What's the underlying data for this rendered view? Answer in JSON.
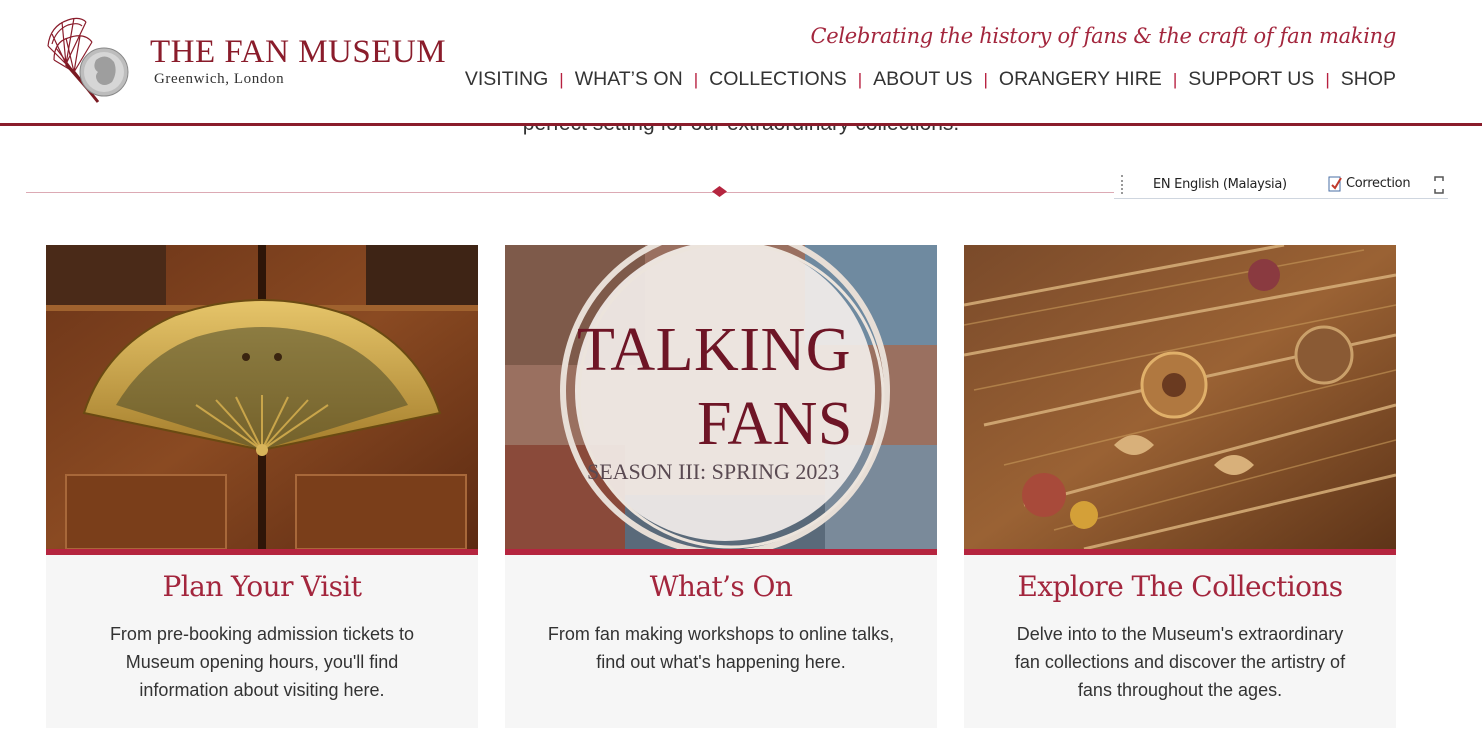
{
  "brand": {
    "title": "THE FAN MUSEUM",
    "subtitle": "Greenwich, London",
    "tagline": "Celebrating the history of fans & the craft of fan making",
    "logo_icon": "fan-and-coin-logo"
  },
  "nav": {
    "items": [
      "VISITING",
      "WHAT’S ON",
      "COLLECTIONS",
      "ABOUT US",
      "ORANGERY HIRE",
      "SUPPORT US",
      "SHOP"
    ],
    "separator": "|"
  },
  "intro": {
    "text": "perfect setting for our extraordinary collections."
  },
  "toolbar": {
    "language": "EN English (Malaysia)",
    "correction": "Correction"
  },
  "cards": [
    {
      "title": "Plan Your Visit",
      "description": "From pre-booking admission tickets to Museum opening hours, you'll find information about visiting here.",
      "image": "gilded-fan-on-wooden-door"
    },
    {
      "title": "What’s On",
      "description": "From fan making workshops to online talks, find out what's happening here.",
      "image": "talking-fans-poster",
      "image_text": {
        "line1": "TALKING",
        "line2": "FANS",
        "line3": "SEASON III: SPRING 2023"
      }
    },
    {
      "title": "Explore The Collections",
      "description": "Delve into to the Museum's extraordinary fan collections and discover the artistry of fans throughout the ages.",
      "image": "embroidered-fan-detail"
    }
  ],
  "colors": {
    "brand": "#8a1c2b",
    "accent": "#b5253f",
    "card_bg": "#f6f6f6"
  }
}
